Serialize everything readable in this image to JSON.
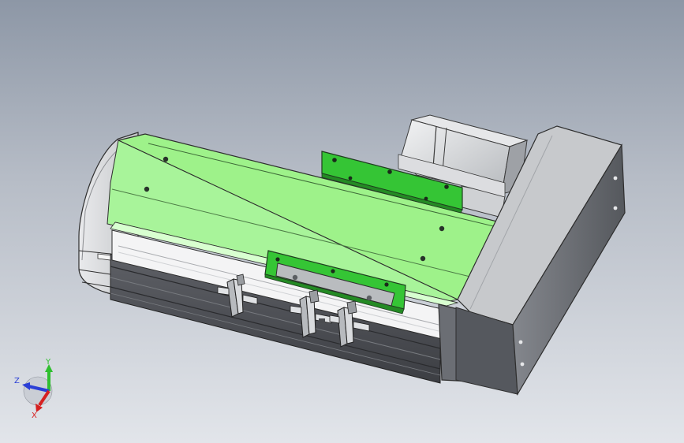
{
  "triad": {
    "x_label": "X",
    "y_label": "Y",
    "z_label": "Z",
    "x_color": "#d62020",
    "y_color": "#2fbf2f",
    "z_color": "#2b3fd6"
  },
  "colors": {
    "carriage_green": "#9ef28a",
    "clamp_green": "#30c030",
    "housing_gray": "#c7c9cc",
    "frame_dark": "#4b4d52"
  }
}
